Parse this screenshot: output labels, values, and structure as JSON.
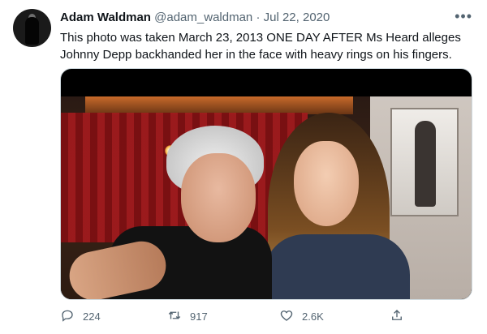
{
  "tweet": {
    "author_name": "Adam Waldman",
    "author_handle": "@adam_waldman",
    "separator": "·",
    "date": "Jul 22, 2020",
    "text": "This photo was taken March 23, 2013 ONE DAY AFTER Ms Heard alleges Johnny Depp backhanded her in the face with heavy rings on his fingers.",
    "more_icon": "more-horizontal-icon"
  },
  "actions": {
    "replies": "224",
    "retweets": "917",
    "likes": "2.6K"
  },
  "colors": {
    "text": "#0f1419",
    "secondary": "#536471",
    "border": "#cfd9de"
  }
}
